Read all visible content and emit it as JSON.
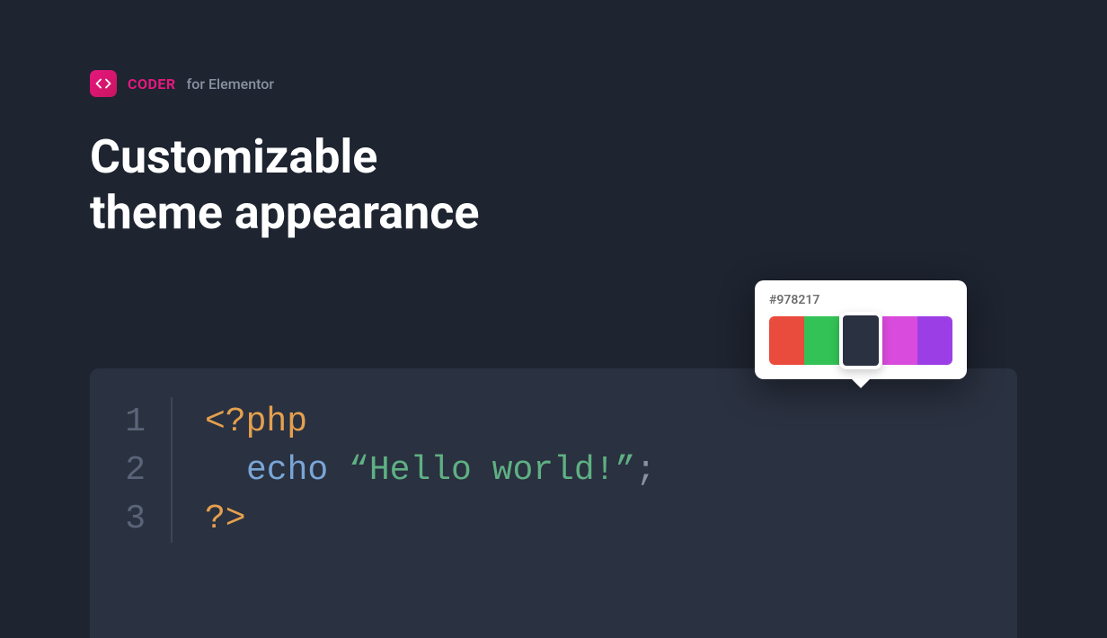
{
  "header": {
    "brand_name": "CODER",
    "brand_suffix": "for Elementor"
  },
  "title": {
    "line1": "Customizable",
    "line2": "theme appearance"
  },
  "code": {
    "line_numbers": [
      "1",
      "2",
      "3"
    ],
    "line1_tag": "<?php",
    "line2_keyword": "echo",
    "line2_string": "“Hello world!”",
    "line2_punct": ";",
    "line3_tag": "?>"
  },
  "color_picker": {
    "label": "#978217",
    "swatches": [
      {
        "name": "red",
        "color": "#e94b3c"
      },
      {
        "name": "green",
        "color": "#33c256"
      },
      {
        "name": "dark",
        "color": "#2a3140"
      },
      {
        "name": "magenta",
        "color": "#d94bdc"
      },
      {
        "name": "purple",
        "color": "#9c3ee5"
      }
    ]
  }
}
